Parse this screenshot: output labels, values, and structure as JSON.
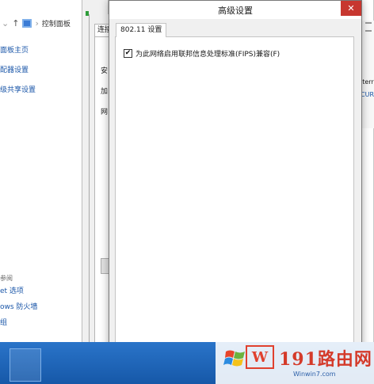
{
  "control_panel": {
    "breadcrumb": "控制面板",
    "links": [
      "面板主页",
      "配器设置",
      "级共享设置"
    ],
    "see_also": "参阅",
    "bottom_links": [
      "et 选项",
      "ows 防火墙",
      "组"
    ],
    "right_text": [
      "iterr",
      "CUR"
    ]
  },
  "properties_window": {
    "tab_label": "连接",
    "labels": [
      "安",
      "加",
      "网"
    ]
  },
  "dialog": {
    "title": "高级设置",
    "close_glyph": "✕",
    "tab_label": "802.11 设置",
    "fips_checkbox": {
      "label": "为此网络启用联邦信息处理标准(FIPS)兼容(F)",
      "checked": true,
      "check_glyph": "✔"
    }
  },
  "watermark": {
    "brand": "191路由网",
    "badge": "W",
    "url": "Winwin7.com"
  },
  "colors": {
    "close_button": "#c7372f",
    "taskbar": "#1a63b8",
    "link": "#1a56a8",
    "watermark_red": "#d43a2a"
  }
}
